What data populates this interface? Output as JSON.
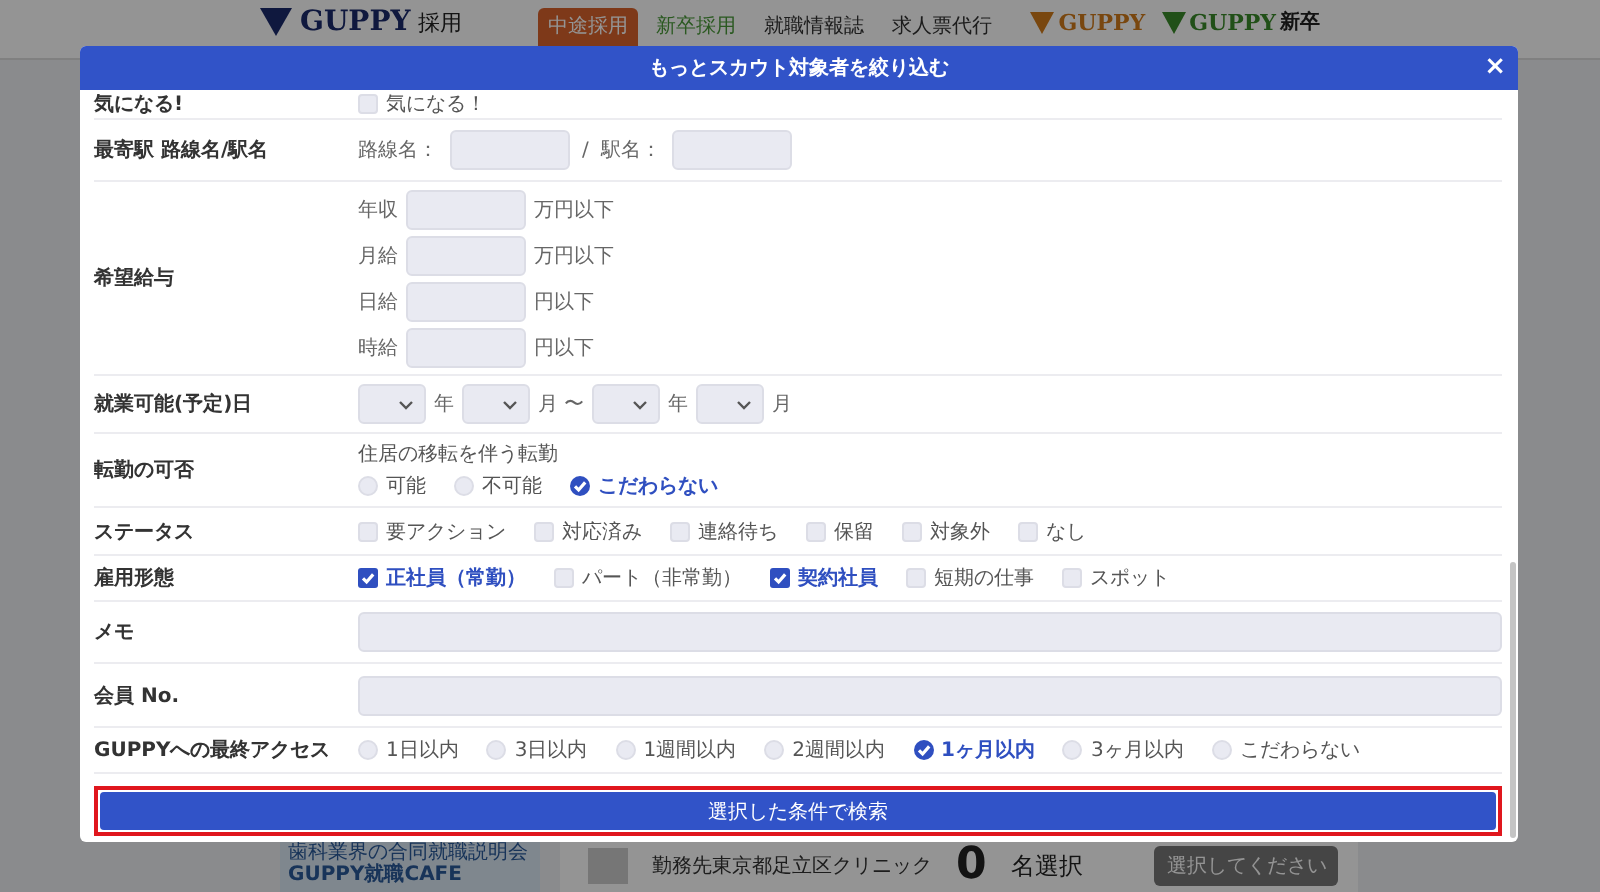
{
  "background_header": {
    "logo_text": "GUPPY",
    "logo_suffix": "採用",
    "nav": [
      {
        "label": "中途採用",
        "selected": true
      },
      {
        "label": "新卒採用",
        "selected": false
      },
      {
        "label": "就職情報誌",
        "selected": false
      },
      {
        "label": "求人票代行",
        "selected": false
      }
    ],
    "brand_logos": [
      {
        "text": "GUPPY"
      },
      {
        "text": "GUPPY",
        "suffix": "新卒"
      }
    ]
  },
  "modal": {
    "title": "もっとスカウト対象者を絞り込む",
    "close": "×",
    "rows": [
      {
        "kind": "checks",
        "label": "気になる!",
        "options": [
          {
            "label": "気になる！",
            "checked": false
          }
        ]
      },
      {
        "kind": "station",
        "label": "最寄駅 路線名/駅名",
        "line_label": "路線名：",
        "separator": "/",
        "station_label": "駅名："
      },
      {
        "kind": "salary",
        "label": "希望給与",
        "items": [
          {
            "name": "年収",
            "unit": "万円以下"
          },
          {
            "name": "月給",
            "unit": "万円以下"
          },
          {
            "name": "日給",
            "unit": "円以下"
          },
          {
            "name": "時給",
            "unit": "円以下"
          }
        ]
      },
      {
        "kind": "date",
        "label": "就業可能(予定)日",
        "selects": [
          {
            "unit": "年"
          },
          {
            "unit": "月 〜"
          },
          {
            "unit": "年"
          },
          {
            "unit": "月"
          }
        ]
      },
      {
        "kind": "radios",
        "label": "転勤の可否",
        "sublabel": "住居の移転を伴う転勤",
        "options": [
          {
            "label": "可能",
            "selected": false
          },
          {
            "label": "不可能",
            "selected": false
          },
          {
            "label": "こだわらない",
            "selected": true
          }
        ]
      },
      {
        "kind": "checks",
        "label": "ステータス",
        "options": [
          {
            "label": "要アクション",
            "checked": false
          },
          {
            "label": "対応済み",
            "checked": false
          },
          {
            "label": "連絡待ち",
            "checked": false
          },
          {
            "label": "保留",
            "checked": false
          },
          {
            "label": "対象外",
            "checked": false
          },
          {
            "label": "なし",
            "checked": false
          }
        ]
      },
      {
        "kind": "checks",
        "label": "雇用形態",
        "options": [
          {
            "label": "正社員（常勤）",
            "checked": true
          },
          {
            "label": "パート（非常勤）",
            "checked": false
          },
          {
            "label": "契約社員",
            "checked": true
          },
          {
            "label": "短期の仕事",
            "checked": false
          },
          {
            "label": "スポット",
            "checked": false
          }
        ]
      },
      {
        "kind": "text",
        "label": "メモ"
      },
      {
        "kind": "text",
        "label": "会員 No."
      },
      {
        "kind": "radios",
        "label": "GUPPYへの最終アクセス",
        "options": [
          {
            "label": "1日以内",
            "selected": false
          },
          {
            "label": "3日以内",
            "selected": false
          },
          {
            "label": "1週間以内",
            "selected": false
          },
          {
            "label": "2週間以内",
            "selected": false
          },
          {
            "label": "1ヶ月以内",
            "selected": true
          },
          {
            "label": "3ヶ月以内",
            "selected": false
          },
          {
            "label": "こだわらない",
            "selected": false
          }
        ]
      }
    ],
    "submit": "選択した条件で検索"
  },
  "background_footer": {
    "banner_lines": [
      "歯科業界の合同就職説明会",
      "GUPPY就職CAFE"
    ],
    "clinic": "勤務先東京都足立区クリニック",
    "count": "0",
    "count_unit": "名選択",
    "button": "選択してください"
  }
}
